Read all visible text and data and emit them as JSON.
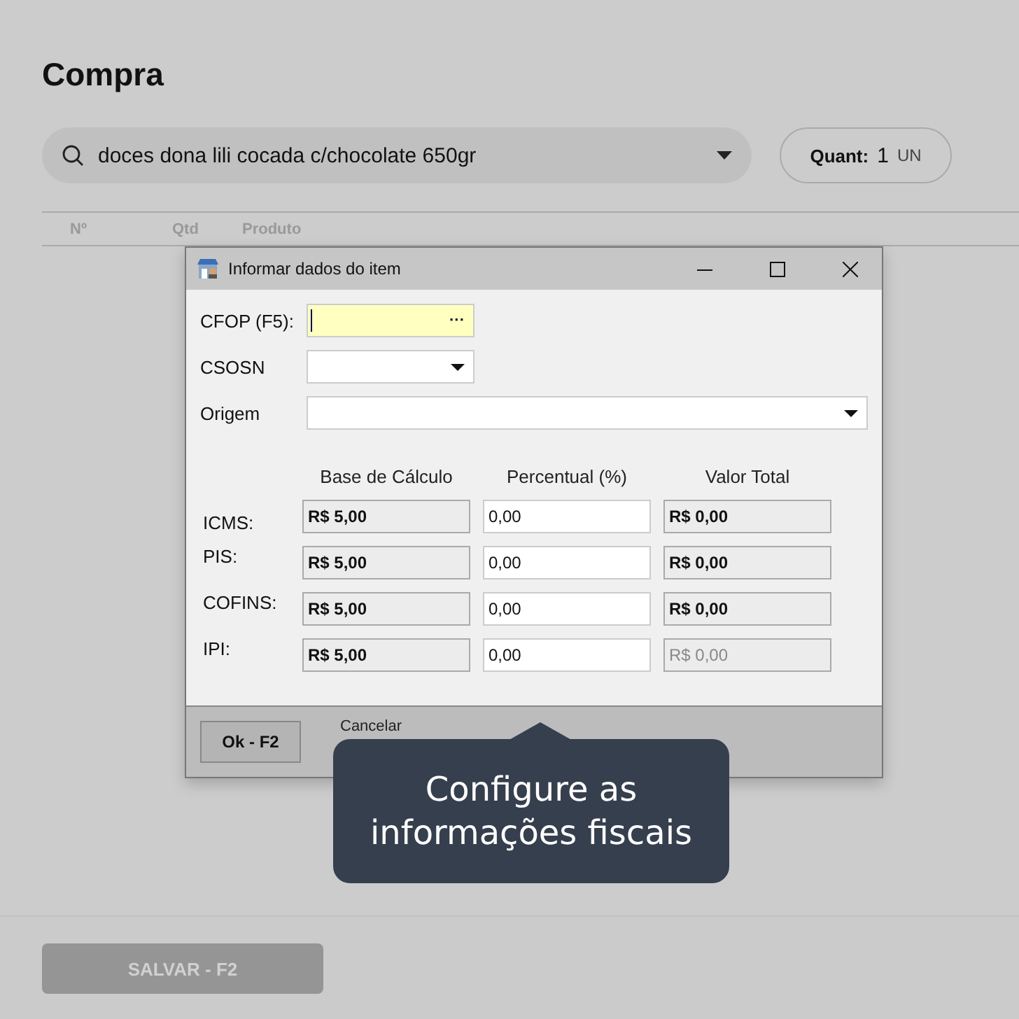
{
  "page": {
    "title": "Compra"
  },
  "search": {
    "value": "doces dona lili cocada c/chocolate 650gr"
  },
  "quantity": {
    "label": "Quant:",
    "value": "1",
    "unit": "UN"
  },
  "table": {
    "columns": [
      "Nº",
      "Qtd",
      "Produto"
    ]
  },
  "dialog": {
    "title": "Informar dados do item",
    "fields": [
      {
        "kind": "lookup",
        "label": "CFOP (F5):",
        "button": "···",
        "focused": true,
        "wide": false
      },
      {
        "kind": "select",
        "label": "CSOSN",
        "focused": false,
        "wide": false
      },
      {
        "kind": "select",
        "label": "Origem",
        "focused": false,
        "wide": true
      }
    ],
    "tax_columns": [
      "Base de Cálculo",
      "Percentual (%)",
      "Valor Total"
    ],
    "tax_rows": [
      {
        "label": "ICMS:",
        "base": "R$ 5,00",
        "percent": "0,00",
        "total": "R$ 0,00",
        "total_disabled": false
      },
      {
        "label": "PIS:",
        "base": "R$ 5,00",
        "percent": "0,00",
        "total": "R$ 0,00",
        "total_disabled": false
      },
      {
        "label": "COFINS:",
        "base": "R$ 5,00",
        "percent": "0,00",
        "total": "R$ 0,00",
        "total_disabled": false
      },
      {
        "label": "IPI:",
        "base": "R$ 5,00",
        "percent": "0,00",
        "total": "R$ 0,00",
        "total_disabled": true
      }
    ],
    "buttons": [
      "Ok - F2",
      "Cancelar"
    ]
  },
  "tooltip": {
    "text": "Configure as informações fiscais"
  },
  "footer": {
    "save_button": "SALVAR - F2",
    "disabled": true
  }
}
